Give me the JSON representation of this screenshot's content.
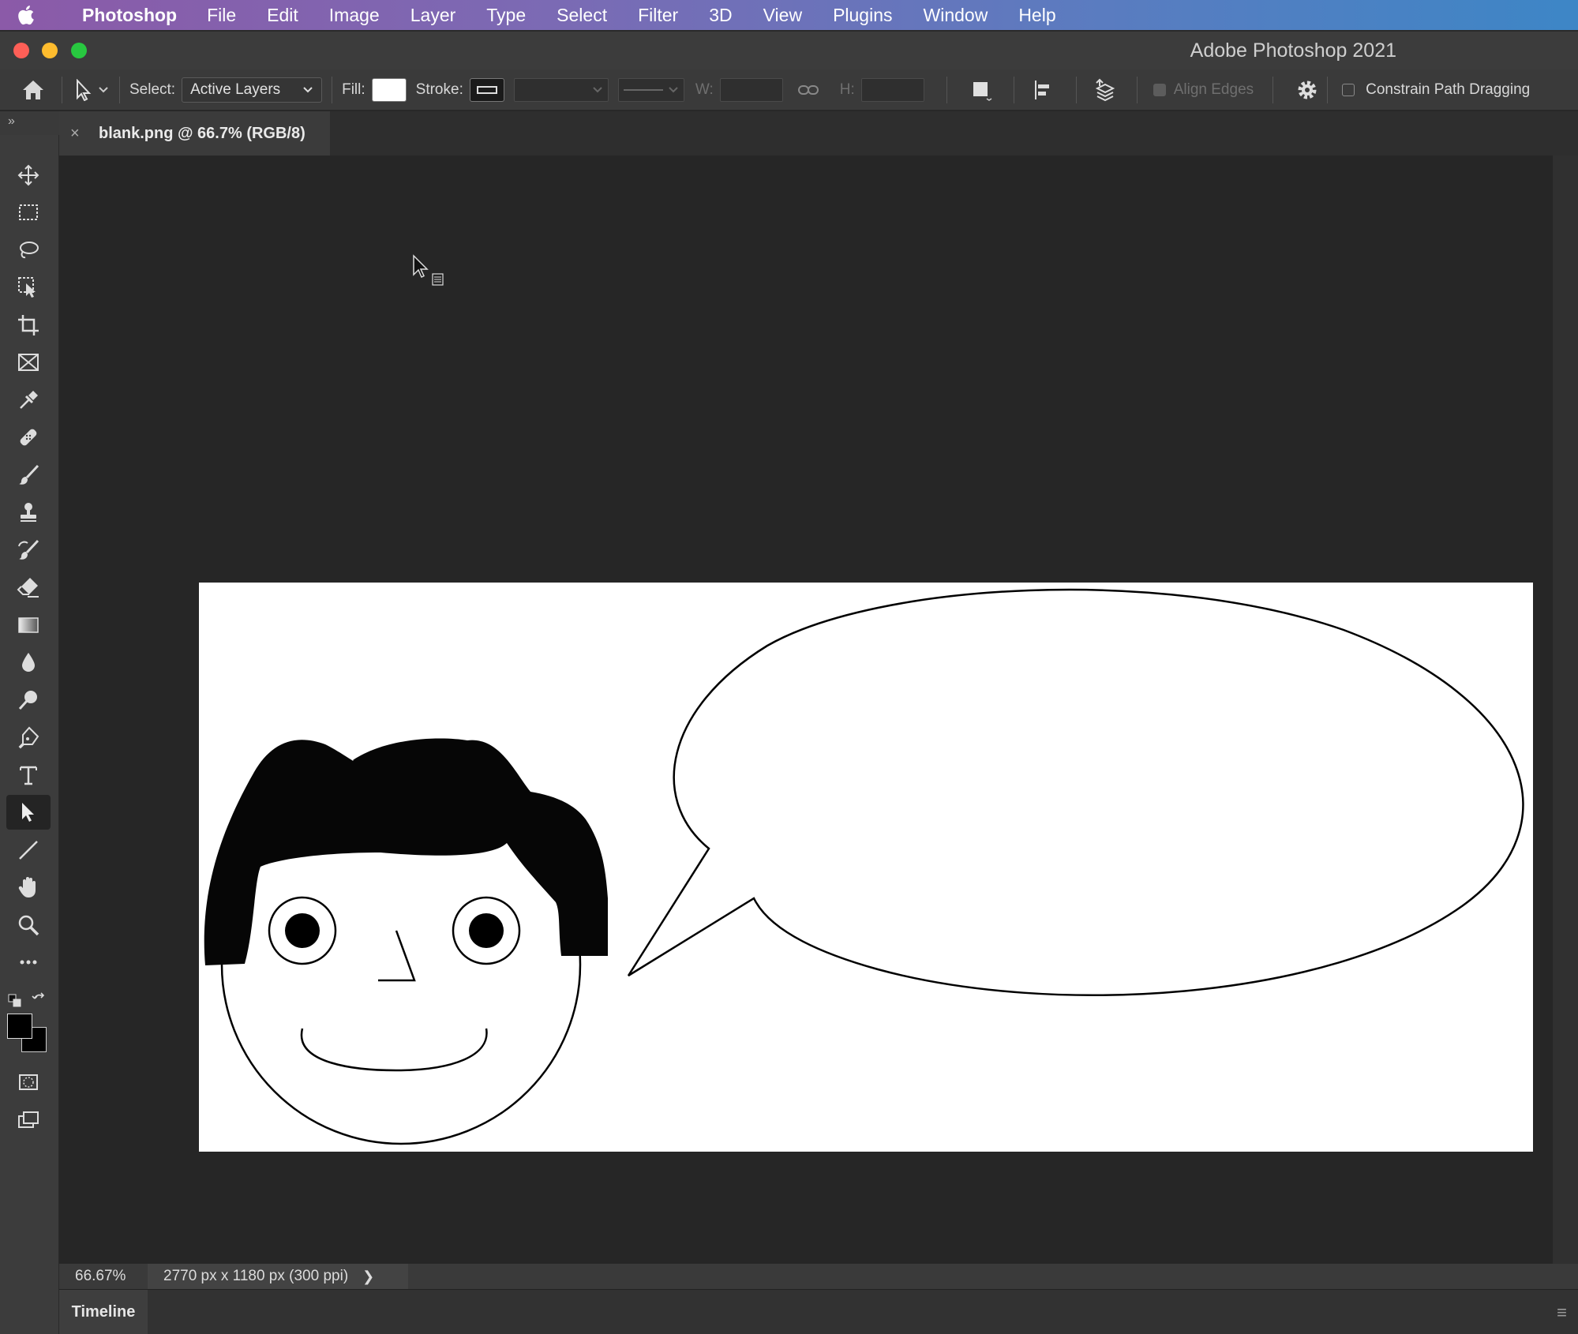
{
  "menubar": {
    "app": "Photoshop",
    "items": [
      "File",
      "Edit",
      "Image",
      "Layer",
      "Type",
      "Select",
      "Filter",
      "3D",
      "View",
      "Plugins",
      "Window",
      "Help"
    ]
  },
  "window": {
    "title": "Adobe Photoshop 2021"
  },
  "options": {
    "select_label": "Select:",
    "select_value": "Active Layers",
    "fill_label": "Fill:",
    "stroke_label": "Stroke:",
    "w_label": "W:",
    "h_label": "H:",
    "align_edges": "Align Edges",
    "constrain": "Constrain Path Dragging"
  },
  "document": {
    "tab_name": "blank.png @ 66.7% (RGB/8)"
  },
  "status": {
    "zoom": "66.67%",
    "doc_info": "2770 px x 1180 px (300 ppi)"
  },
  "timeline": {
    "label": "Timeline"
  },
  "colors": {
    "foreground": "#000000",
    "background": "#000000",
    "canvas": "#ffffff",
    "fill_swatch": "#ffffff"
  },
  "tools": [
    "move-tool",
    "marquee-tool",
    "lasso-tool",
    "object-selection-tool",
    "crop-tool",
    "frame-tool",
    "eyedropper-tool",
    "healing-brush-tool",
    "brush-tool",
    "clone-stamp-tool",
    "history-brush-tool",
    "eraser-tool",
    "gradient-tool",
    "blur-tool",
    "dodge-tool",
    "pen-tool",
    "type-tool",
    "path-selection-tool",
    "line-tool",
    "hand-tool",
    "zoom-tool",
    "edit-toolbar",
    "quick-mask",
    "screen-mode"
  ]
}
